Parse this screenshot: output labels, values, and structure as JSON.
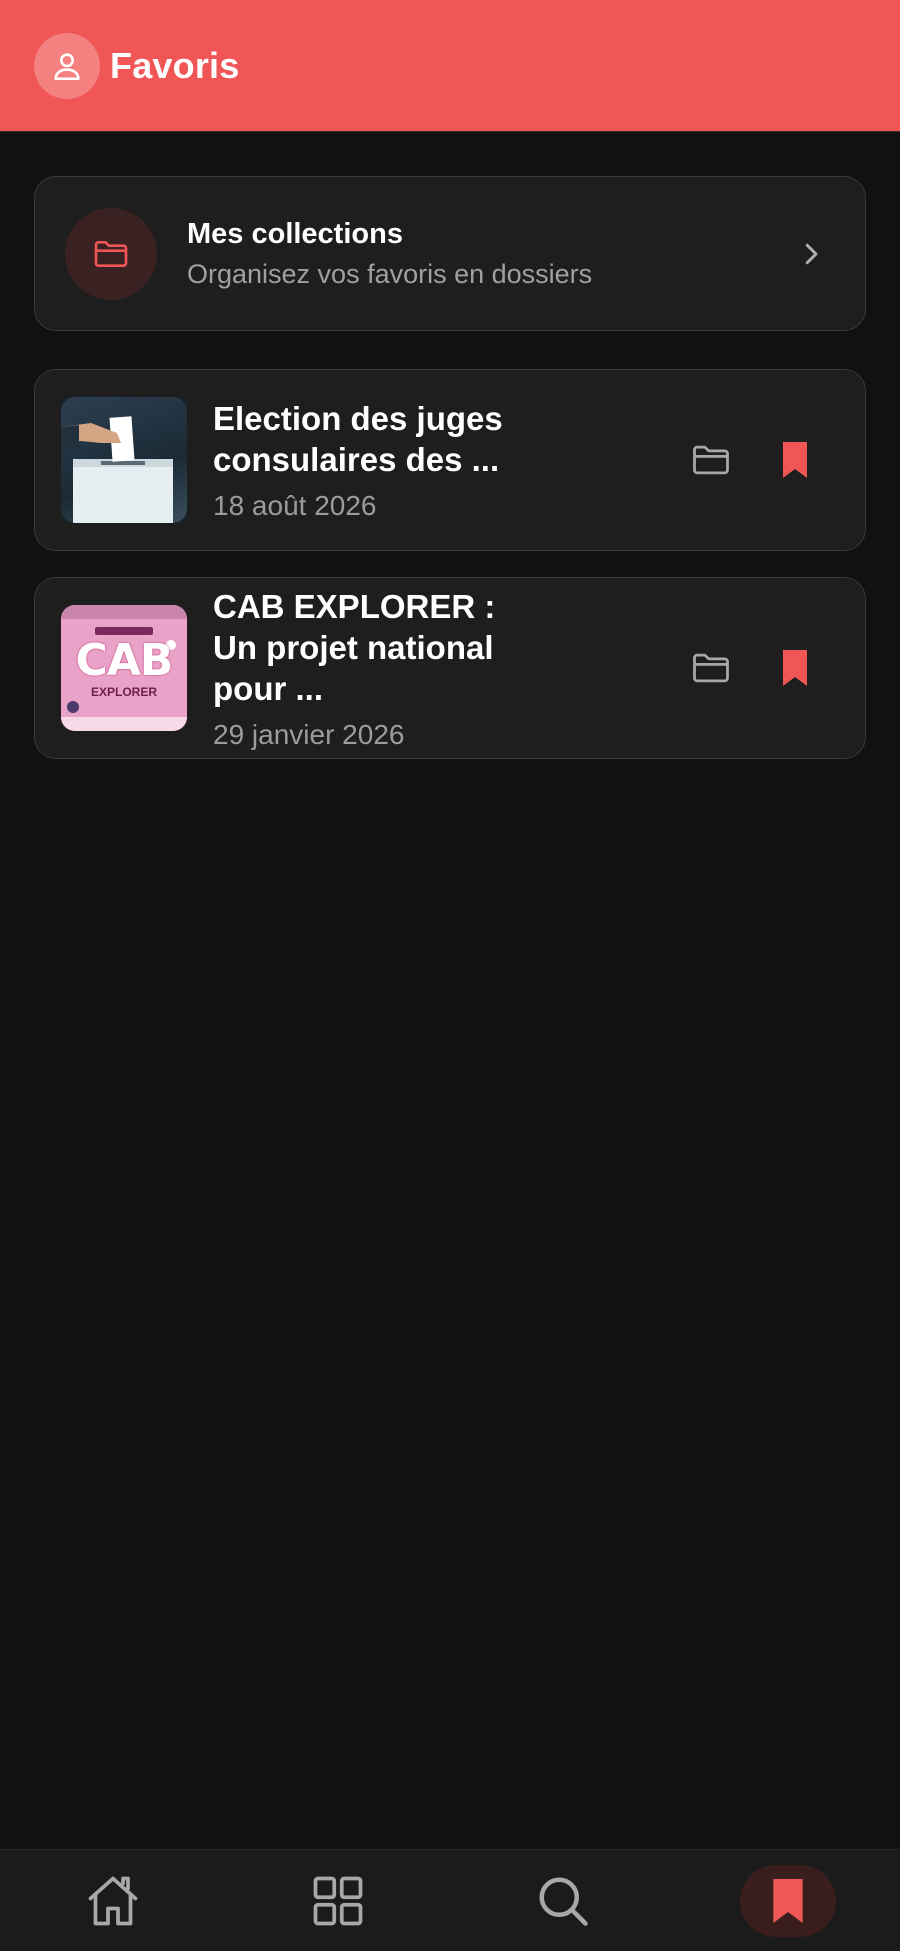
{
  "header": {
    "title": "Favoris",
    "avatar_icon": "user-icon",
    "color": "#f05656"
  },
  "collections": {
    "title": "Mes collections",
    "subtitle": "Organisez vos favoris en dossiers",
    "icon": "folder-icon",
    "chevron_icon": "chevron-right-icon"
  },
  "articles": [
    {
      "title": "Election des juges consulaires des ...",
      "date": "18 août 2026",
      "thumbnail": "ballot-box-image",
      "folder_icon": "folder-icon",
      "bookmark_icon": "bookmark-icon"
    },
    {
      "title": "CAB EXPLORER : Un projet national pour ...",
      "date": "29 janvier 2026",
      "thumbnail": "cab-explorer-poster",
      "thumb_text": "CAB",
      "thumb_subtext": "EXPLORER",
      "folder_icon": "folder-icon",
      "bookmark_icon": "bookmark-icon"
    }
  ],
  "nav": {
    "items": [
      {
        "name": "home",
        "icon": "home-icon",
        "active": false
      },
      {
        "name": "categories",
        "icon": "grid-icon",
        "active": false
      },
      {
        "name": "search",
        "icon": "search-icon",
        "active": false
      },
      {
        "name": "favorites",
        "icon": "bookmark-icon",
        "active": true
      }
    ]
  },
  "colors": {
    "accent": "#f05656",
    "background": "#111111",
    "card": "#1e1e1e"
  }
}
